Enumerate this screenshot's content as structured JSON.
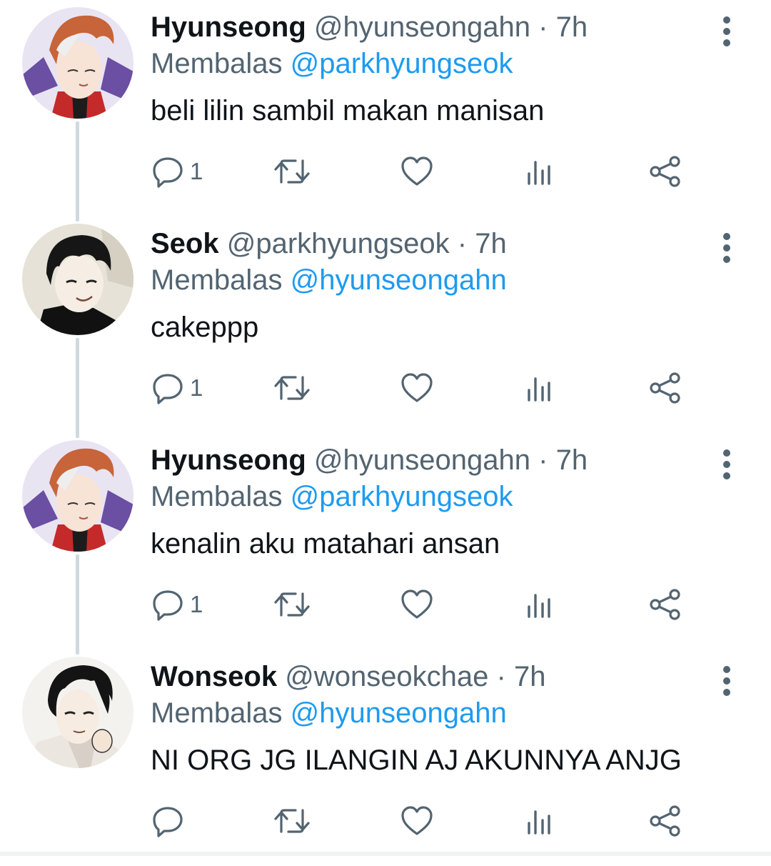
{
  "colors": {
    "text": "#0f1419",
    "secondary": "#536471",
    "link": "#1d9bf0",
    "thread_line": "#cfd9de"
  },
  "tweets": [
    {
      "display_name": "Hyunseong",
      "handle": "@hyunseongahn",
      "separator": "·",
      "time": "7h",
      "reply_prefix": "Membalas",
      "reply_to": "@parkhyungseok",
      "text": "beli lilin sambil makan manisan",
      "reply_count": "1",
      "avatar": "hyunseong-avatar"
    },
    {
      "display_name": "Seok",
      "handle": "@parkhyungseok",
      "separator": "·",
      "time": "7h",
      "reply_prefix": "Membalas",
      "reply_to": "@hyunseongahn",
      "text": "cakeppp",
      "reply_count": "1",
      "avatar": "seok-avatar"
    },
    {
      "display_name": "Hyunseong",
      "handle": "@hyunseongahn",
      "separator": "·",
      "time": "7h",
      "reply_prefix": "Membalas",
      "reply_to": "@parkhyungseok",
      "text": "kenalin aku matahari ansan",
      "reply_count": "1",
      "avatar": "hyunseong-avatar"
    },
    {
      "display_name": "Wonseok",
      "handle": "@wonseokchae",
      "separator": "·",
      "time": "7h",
      "reply_prefix": "Membalas",
      "reply_to": "@hyunseongahn",
      "text": "NI ORG JG ILANGIN AJ AKUNNYA ANJG",
      "reply_count": "",
      "avatar": "wonseok-avatar"
    }
  ],
  "icons": {
    "more": "more-vertical-icon",
    "reply": "reply-bubble-icon",
    "retweet": "retweet-icon",
    "like": "heart-icon",
    "views": "views-bar-chart-icon",
    "share": "share-icon"
  }
}
